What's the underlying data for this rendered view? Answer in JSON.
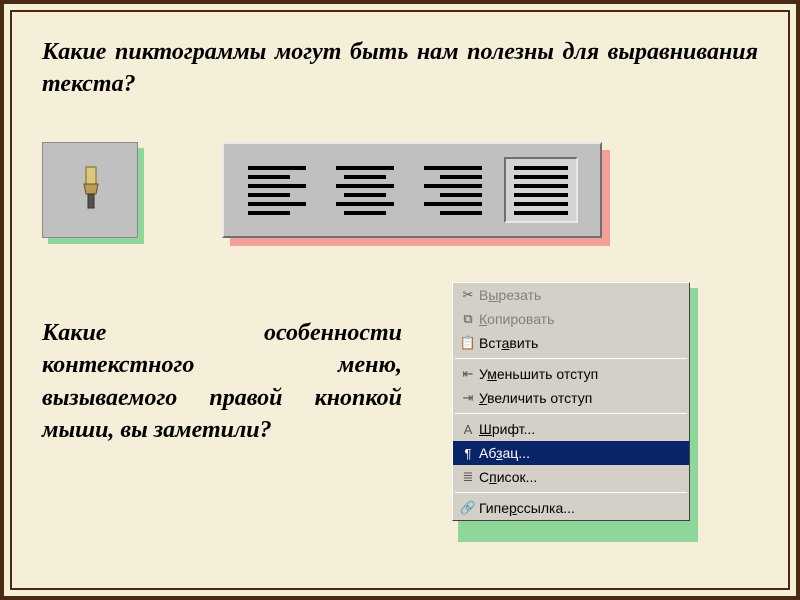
{
  "question1": "Какие пиктограммы могут быть нам полезны для выравнивания текста?",
  "question2": "Какие особенности контекстного меню, вызываемого правой кнопкой мыши, вы заметили?",
  "toolbar": {
    "brush_icon": "format-painter",
    "align": [
      "left",
      "center",
      "right",
      "justify"
    ],
    "active_index": 3
  },
  "context_menu": {
    "items": [
      {
        "icon": "cut",
        "label": "Вырезать",
        "u": 1,
        "disabled": true
      },
      {
        "icon": "copy",
        "label": "Копировать",
        "u": 0,
        "disabled": true
      },
      {
        "icon": "paste",
        "label": "Вставить",
        "u": 3
      },
      {
        "sep": true
      },
      {
        "icon": "unindent",
        "label": "Уменьшить отступ",
        "u": 1
      },
      {
        "icon": "indent",
        "label": "Увеличить отступ",
        "u": 0
      },
      {
        "sep": true
      },
      {
        "icon": "font",
        "label": "Шрифт...",
        "u": 0
      },
      {
        "icon": "para",
        "label": "Абзац...",
        "u": 2,
        "selected": true
      },
      {
        "icon": "list",
        "label": "Список...",
        "u": 1
      },
      {
        "sep": true
      },
      {
        "icon": "link",
        "label": "Гиперссылка...",
        "u": 4
      }
    ]
  }
}
